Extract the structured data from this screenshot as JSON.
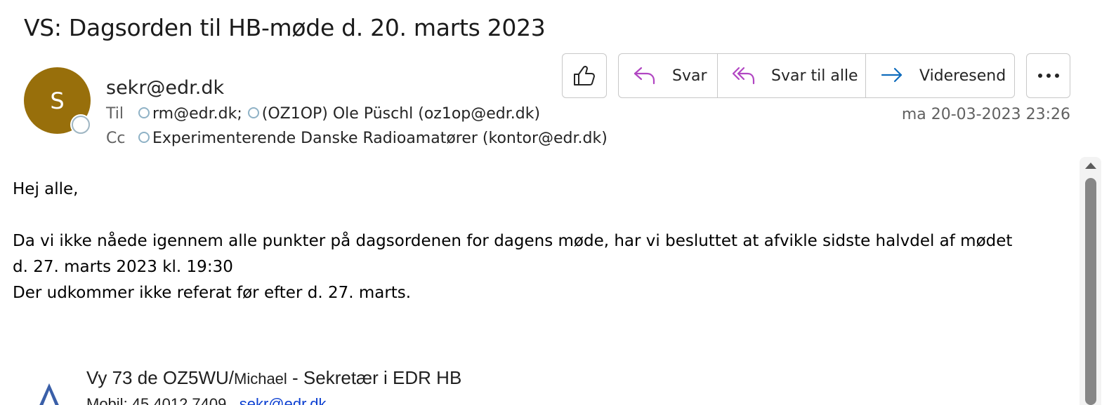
{
  "message": {
    "subject": "VS: Dagsorden til HB-møde d. 20. marts 2023",
    "avatar_initial": "S",
    "avatar_color": "#986f0b",
    "sender": "sekr@edr.dk",
    "to_label": "Til",
    "to_recipients": [
      "rm@edr.dk;",
      "(OZ1OP) Ole Püschl (oz1op@edr.dk)"
    ],
    "cc_label": "Cc",
    "cc_recipients": [
      "Experimenterende Danske Radioamatører (kontor@edr.dk)"
    ],
    "date": "ma 20-03-2023 23:26"
  },
  "actions": {
    "like_icon": "thumbs-up-icon",
    "reply_label": "Svar",
    "reply_all_label": "Svar til alle",
    "forward_label": "Videresend",
    "more_icon": "more-horizontal-icon",
    "reply_color": "#b146c2",
    "forward_color": "#0f6cbd"
  },
  "body": {
    "greeting": "Hej alle,",
    "line1": "Da vi ikke nåede igennem alle punkter på dagsordenen for dagens møde, har vi besluttet at afvikle sidste halvdel af mødet",
    "line2": "d. 27. marts 2023 kl. 19:30",
    "line3": "Der udkommer ikke referat før efter d. 27. marts."
  },
  "signature": {
    "line1_main": "Vy 73 de OZ5WU/",
    "line1_name": "Michael",
    "line1_role": " - Sekretær i EDR HB",
    "line2_partial": "Mobil: 45 4012 7409",
    "line2_link": "sekr@edr.dk"
  }
}
